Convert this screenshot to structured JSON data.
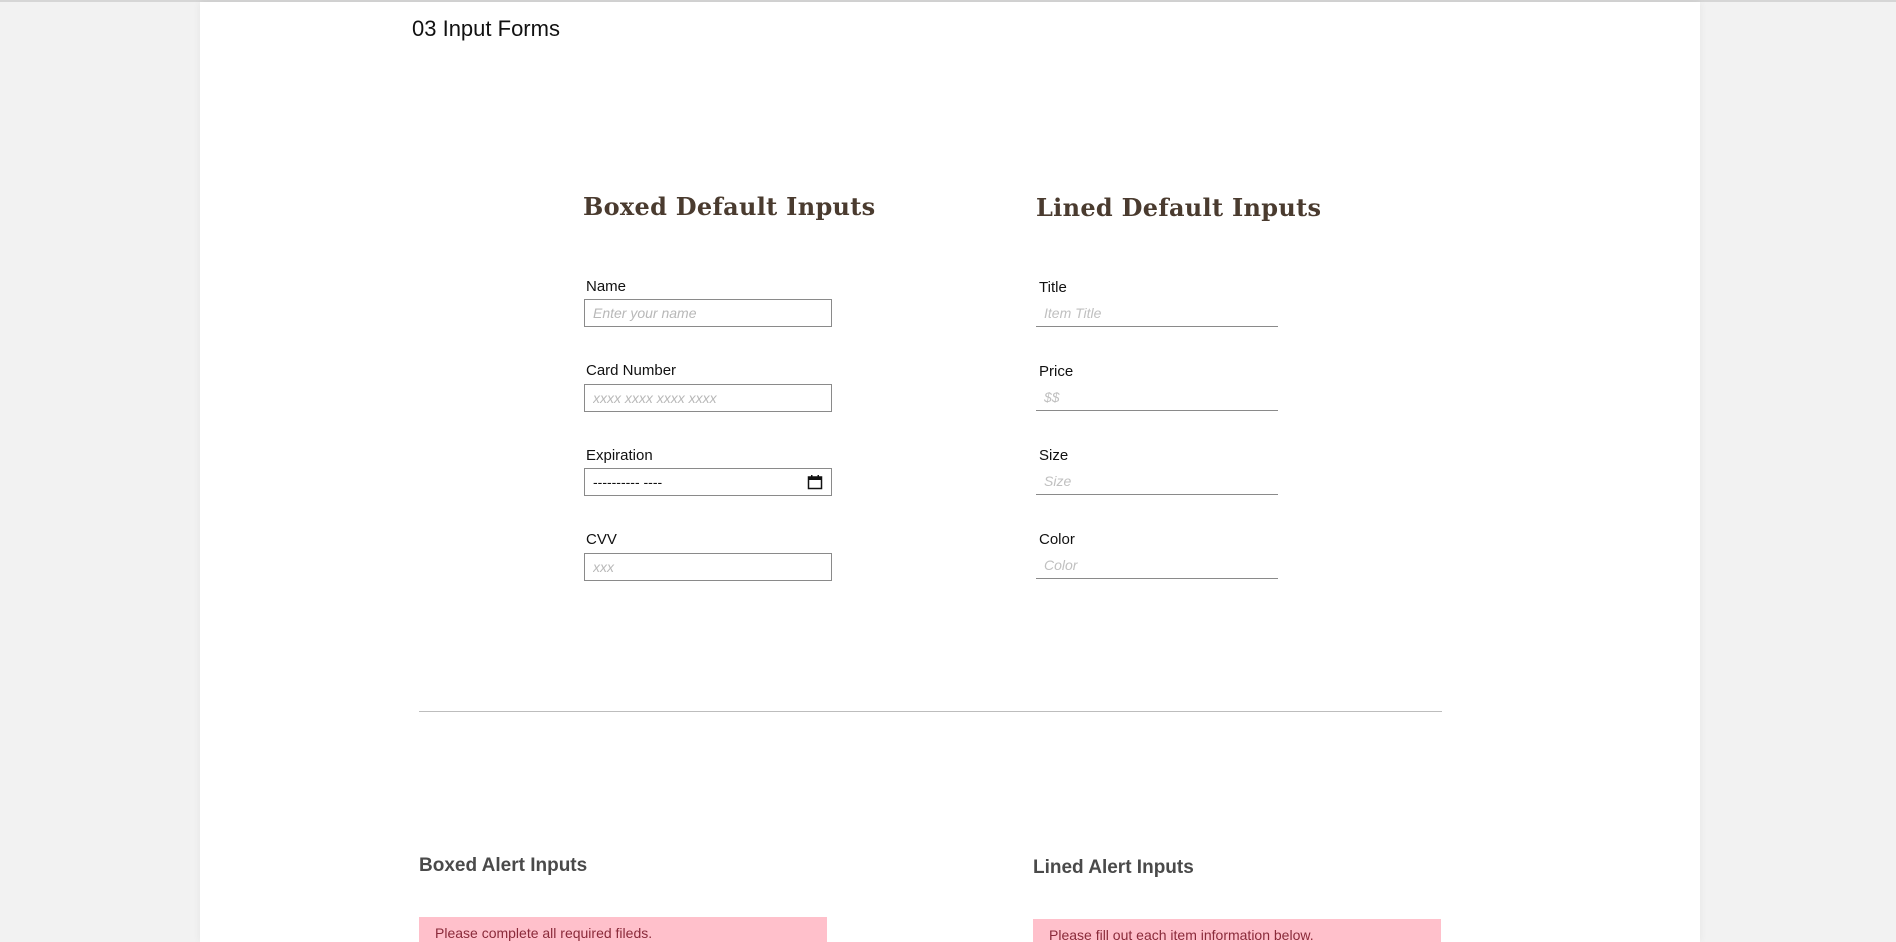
{
  "page": {
    "title": "03 Input Forms"
  },
  "boxed_default": {
    "heading": "Boxed Default Inputs",
    "fields": {
      "name": {
        "label": "Name",
        "placeholder": "Enter your name"
      },
      "card": {
        "label": "Card Number",
        "placeholder": "xxxx xxxx xxxx xxxx"
      },
      "expiration": {
        "label": "Expiration",
        "value": "---------- ----",
        "icon": "calendar-icon"
      },
      "cvv": {
        "label": "CVV",
        "placeholder": "xxx"
      }
    }
  },
  "lined_default": {
    "heading": "Lined Default Inputs",
    "fields": {
      "title": {
        "label": "Title",
        "placeholder": "Item Title"
      },
      "price": {
        "label": "Price",
        "placeholder": "$$"
      },
      "size": {
        "label": "Size",
        "placeholder": "Size"
      },
      "color": {
        "label": "Color",
        "placeholder": "Color"
      }
    }
  },
  "boxed_alert": {
    "heading": "Boxed Alert Inputs",
    "message": "Please complete all required fileds."
  },
  "lined_alert": {
    "heading": "Lined Alert Inputs",
    "message": "Please fill out each item information below."
  },
  "colors": {
    "heading_brown": "#4a3b2f",
    "alert_bg": "#ffc0cb",
    "alert_text": "#8a2a3a"
  }
}
